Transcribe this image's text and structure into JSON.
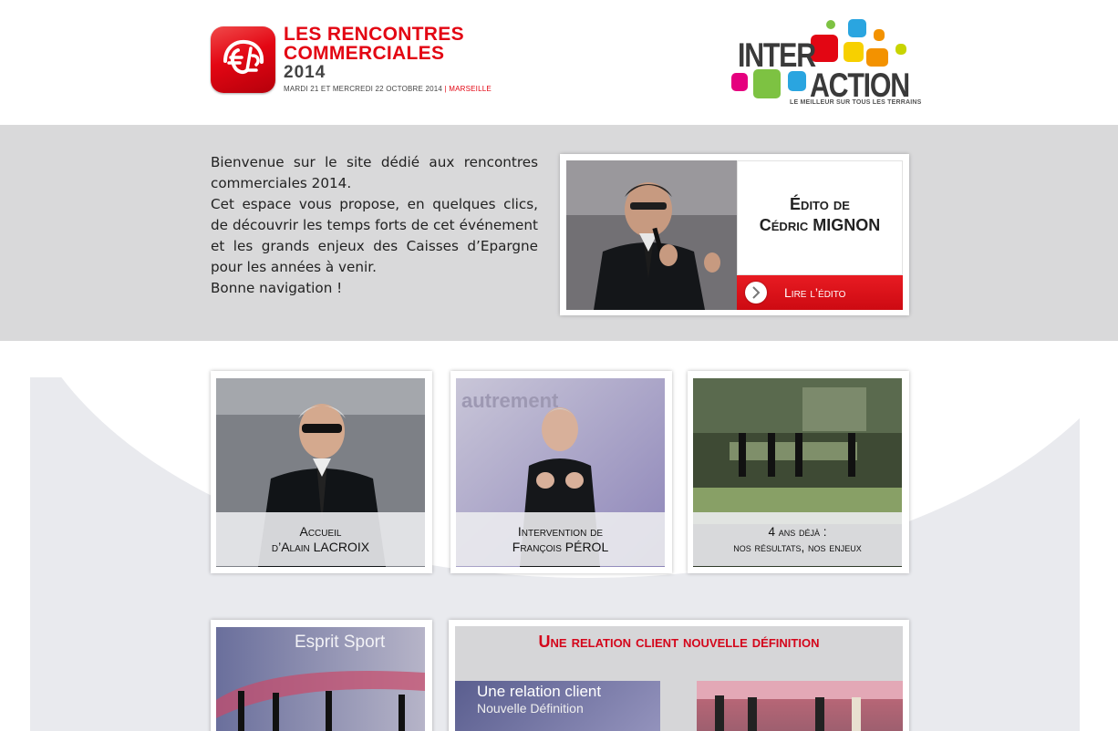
{
  "header": {
    "logo_line1": "LES RENCONTRES",
    "logo_line2": "COMMERCIALES",
    "logo_year": "2014",
    "logo_date": "MARDI 21 ET MERCREDI 22 OCTOBRE 2014",
    "logo_date_sep": "|",
    "logo_city": "MARSEILLE",
    "ia_word1": "INTER",
    "ia_word2": "ACTION",
    "ia_tagline": "LE MEILLEUR SUR TOUS LES TERRAINS"
  },
  "intro": {
    "text_line1": "Bienvenue sur le site dédié aux rencontres commerciales 2014.",
    "text_line2": "Cet espace vous propose, en quelques clics, de découvrir les temps forts de cet événement et les grands enjeux des Caisses d’Epargne pour les années à venir.",
    "text_line3": "Bonne navigation !"
  },
  "edito": {
    "title_line1": "Édito de",
    "title_line2": "Cédric MIGNON",
    "button_label": "Lire l’édito"
  },
  "cards": [
    {
      "line1": "Accueil",
      "line2": "d’Alain LACROIX"
    },
    {
      "line1": "Intervention de",
      "line2": "François PÉROL"
    },
    {
      "line1": "4 ans déjà :",
      "line2": "nos résultats, nos enjeux"
    }
  ],
  "lower": {
    "sport_banner": "Esprit Sport",
    "relation_title": "Une relation client nouvelle définition",
    "relation_screen_line1": "Une relation client",
    "relation_screen_line2": "Nouvelle Définition"
  },
  "colors": {
    "brand_red": "#e30613",
    "intro_bg": "#d9d9da",
    "arch_bg": "#e9eaee"
  }
}
